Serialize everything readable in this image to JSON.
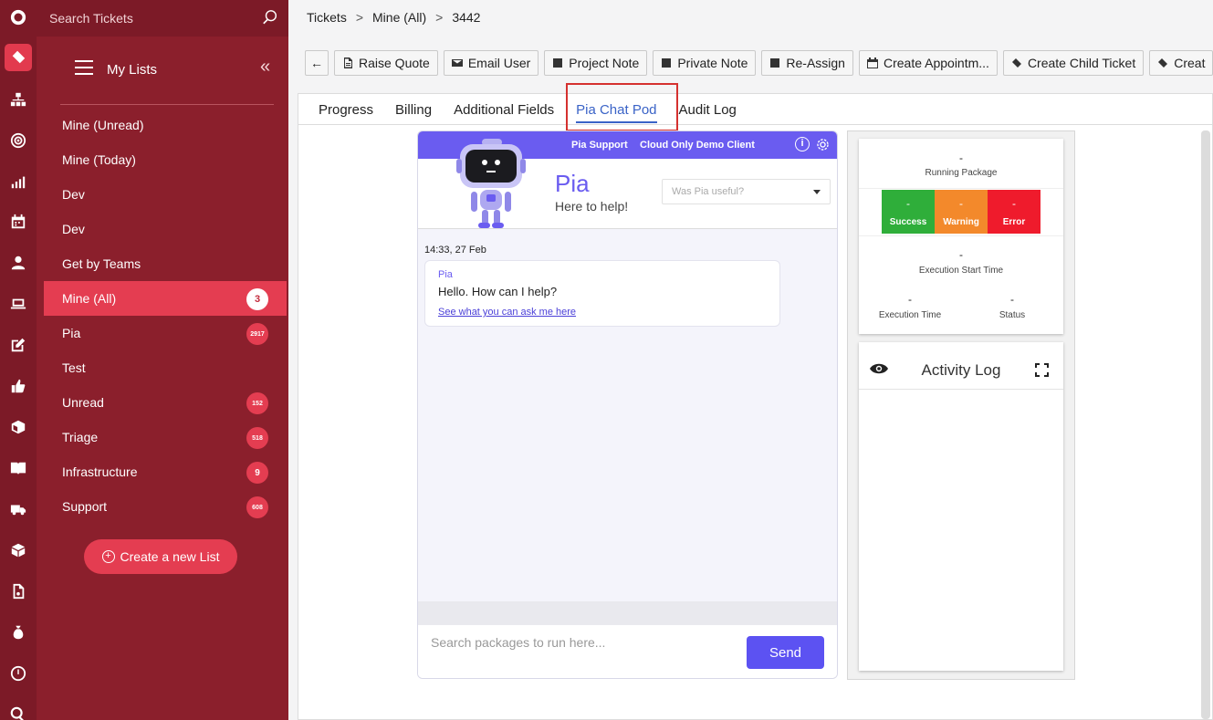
{
  "search": {
    "placeholder": "Search Tickets"
  },
  "sidebar": {
    "title": "My Lists",
    "collapse_glyph": "«",
    "items": [
      {
        "label": "Mine (Unread)",
        "count": ""
      },
      {
        "label": "Mine (Today)",
        "count": ""
      },
      {
        "label": "Dev",
        "count": ""
      },
      {
        "label": "Dev",
        "count": ""
      },
      {
        "label": "Get by Teams",
        "count": ""
      },
      {
        "label": "Mine (All)",
        "count": "3"
      },
      {
        "label": "Pia",
        "count": "2917"
      },
      {
        "label": "Test",
        "count": ""
      },
      {
        "label": "Unread",
        "count": "152"
      },
      {
        "label": "Triage",
        "count": "518"
      },
      {
        "label": "Infrastructure",
        "count": "9"
      },
      {
        "label": "Support",
        "count": "608"
      }
    ],
    "create_label": "Create a new List"
  },
  "rail_icons": [
    "logo-icon",
    "ticket-icon",
    "org-chart-icon",
    "target-icon",
    "chart-icon",
    "calendar-icon",
    "user-icon",
    "laptop-icon",
    "edit-icon",
    "thumbs-up-icon",
    "box-icon",
    "book-icon",
    "truck-icon",
    "package-icon",
    "document-icon",
    "money-bag-icon",
    "clock-icon",
    "search-icon"
  ],
  "breadcrumb": [
    "Tickets",
    "Mine (All)",
    "3442"
  ],
  "breadcrumb_sep": ">",
  "toolbar": {
    "back_glyph": "←",
    "buttons": [
      "Raise Quote",
      "Email User",
      "Project Note",
      "Private Note",
      "Re-Assign",
      "Create Appointm...",
      "Create Child Ticket",
      "Creat"
    ]
  },
  "tabs": [
    "Progress",
    "Billing",
    "Additional Fields",
    "Pia Chat Pod",
    "Audit Log"
  ],
  "active_tab": 3,
  "chat": {
    "support_label": "Pia Support",
    "client_label": "Cloud Only Demo Client",
    "info_glyph": "i",
    "name": "Pia",
    "tagline": "Here to help!",
    "useful_placeholder": "Was Pia useful?",
    "message_time": "14:33, 27 Feb",
    "message_sender": "Pia",
    "message_text": "Hello. How can I help?",
    "message_link": "See what you can ask me here",
    "input_placeholder": "Search packages to run here...",
    "send_label": "Send"
  },
  "status": {
    "running_value": "-",
    "running_label": "Running Package",
    "tiles": [
      {
        "label": "Success",
        "value": "-",
        "color": "#2fae3a"
      },
      {
        "label": "Warning",
        "value": "-",
        "color": "#f3892b"
      },
      {
        "label": "Error",
        "value": "-",
        "color": "#ef1b2c"
      }
    ],
    "start_value": "-",
    "start_label": "Execution Start Time",
    "exec_time_value": "-",
    "exec_time_label": "Execution Time",
    "status_value": "-",
    "status_label": "Status"
  },
  "activity": {
    "title": "Activity Log"
  },
  "colors": {
    "accent": "#e43d51",
    "sidebar": "#8b1f2c",
    "rail": "#7c1a27",
    "pia": "#6a5cf0",
    "tab_active": "#3a63c7",
    "highlight": "#d5312f"
  }
}
